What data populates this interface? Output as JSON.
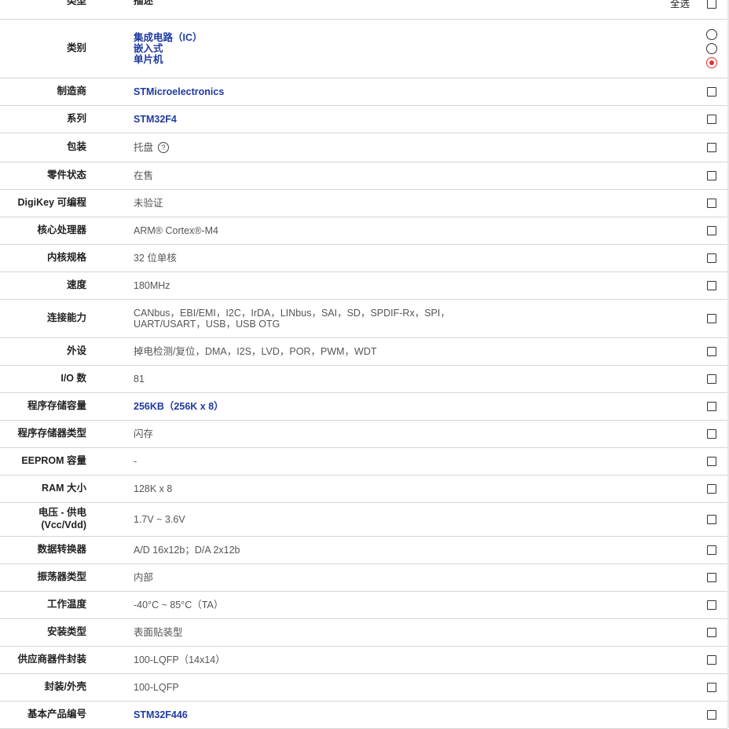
{
  "header": {
    "type_label": "类型",
    "desc_label": "描述",
    "select_all": "全选"
  },
  "category": {
    "label": "类别",
    "options": [
      "集成电路（IC）",
      "嵌入式",
      "单片机"
    ],
    "selected_index": 2
  },
  "rows": [
    {
      "label": "制造商",
      "value": "STMicroelectronics",
      "link": true
    },
    {
      "label": "系列",
      "value": "STM32F4",
      "link": true
    },
    {
      "label": "包装",
      "value": "托盘",
      "help": true
    },
    {
      "label": "零件状态",
      "value": "在售"
    },
    {
      "label": "DigiKey 可编程",
      "value": "未验证"
    },
    {
      "label": "核心处理器",
      "value": "ARM® Cortex®-M4"
    },
    {
      "label": "内核规格",
      "value": "32 位单核"
    },
    {
      "label": "速度",
      "value": "180MHz"
    },
    {
      "label": "连接能力",
      "value": "CANbus，EBI/EMI，I2C，IrDA，LINbus，SAI，SD，SPDIF-Rx，SPI，",
      "value2": "UART/USART，USB，USB OTG"
    },
    {
      "label": "外设",
      "value": "掉电检测/复位，DMA，I2S，LVD，POR，PWM，WDT"
    },
    {
      "label": "I/O 数",
      "value": "81"
    },
    {
      "label": "程序存储容量",
      "value": "256KB（256K x 8）",
      "link": true
    },
    {
      "label": "程序存储器类型",
      "value": "闪存"
    },
    {
      "label": "EEPROM 容量",
      "value": "-"
    },
    {
      "label": "RAM 大小",
      "value": "128K x 8"
    },
    {
      "label": "电压 - 供电",
      "label2": "(Vcc/Vdd)",
      "value": "1.7V ~ 3.6V"
    },
    {
      "label": "数据转换器",
      "value": "A/D 16x12b；D/A 2x12b"
    },
    {
      "label": "振荡器类型",
      "value": "内部"
    },
    {
      "label": "工作温度",
      "value": "-40°C ~ 85°C（TA）"
    },
    {
      "label": "安装类型",
      "value": "表面贴装型"
    },
    {
      "label": "供应商器件封装",
      "value": "100-LQFP（14x14）"
    },
    {
      "label": "封装/外壳",
      "value": "100-LQFP"
    },
    {
      "label": "基本产品编号",
      "value": "STM32F446",
      "link": true
    }
  ],
  "colors": {
    "link": "#1f3aa3",
    "radio_selected": "#e53030",
    "divider": "#d6d6d6"
  }
}
